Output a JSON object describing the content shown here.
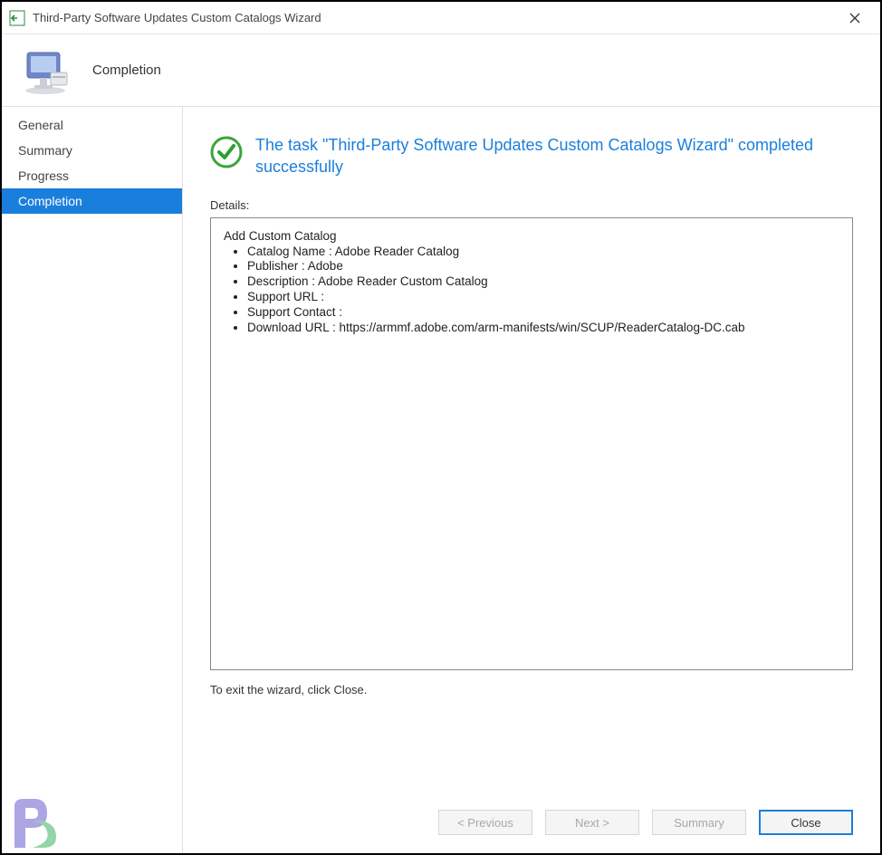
{
  "window": {
    "title": "Third-Party Software Updates Custom Catalogs Wizard"
  },
  "header": {
    "title": "Completion"
  },
  "sidebar": {
    "items": [
      {
        "label": "General"
      },
      {
        "label": "Summary"
      },
      {
        "label": "Progress"
      },
      {
        "label": "Completion"
      }
    ]
  },
  "status": {
    "message": "The task \"Third-Party Software Updates Custom Catalogs Wizard\" completed successfully"
  },
  "details": {
    "label": "Details:",
    "heading": "Add Custom Catalog",
    "items": [
      "Catalog Name : Adobe Reader Catalog",
      "Publisher : Adobe",
      "Description : Adobe Reader Custom Catalog",
      "Support URL :",
      "Support Contact :",
      "Download URL : https://armmf.adobe.com/arm-manifests/win/SCUP/ReaderCatalog-DC.cab"
    ],
    "exit_hint": "To exit the wizard, click Close."
  },
  "buttons": {
    "previous": "< Previous",
    "next": "Next >",
    "summary": "Summary",
    "close": "Close"
  }
}
